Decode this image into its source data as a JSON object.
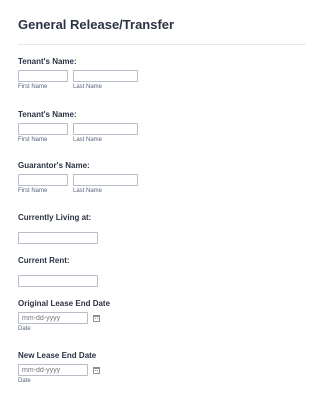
{
  "form": {
    "title": "General Release/Transfer"
  },
  "fields": {
    "tenant1": {
      "label": "Tenant's Name:",
      "first_sublabel": "First Name",
      "last_sublabel": "Last Name",
      "first_value": "",
      "last_value": ""
    },
    "tenant2": {
      "label": "Tenant's Name:",
      "first_sublabel": "First Name",
      "last_sublabel": "Last Name",
      "first_value": "",
      "last_value": ""
    },
    "guarantor": {
      "label": "Guarantor's Name:",
      "first_sublabel": "First Name",
      "last_sublabel": "Last Name",
      "first_value": "",
      "last_value": ""
    },
    "currently_living": {
      "label": "Currently Living at:",
      "value": ""
    },
    "current_rent": {
      "label": "Current Rent:",
      "value": ""
    },
    "original_lease_end": {
      "label": "Original Lease End Date",
      "placeholder": "mm-dd-yyyy",
      "sublabel": "Date",
      "icon": "calendar-icon"
    },
    "new_lease_end": {
      "label": "New Lease End Date",
      "placeholder": "mm-dd-yyyy",
      "sublabel": "Date",
      "icon": "calendar-icon"
    }
  }
}
